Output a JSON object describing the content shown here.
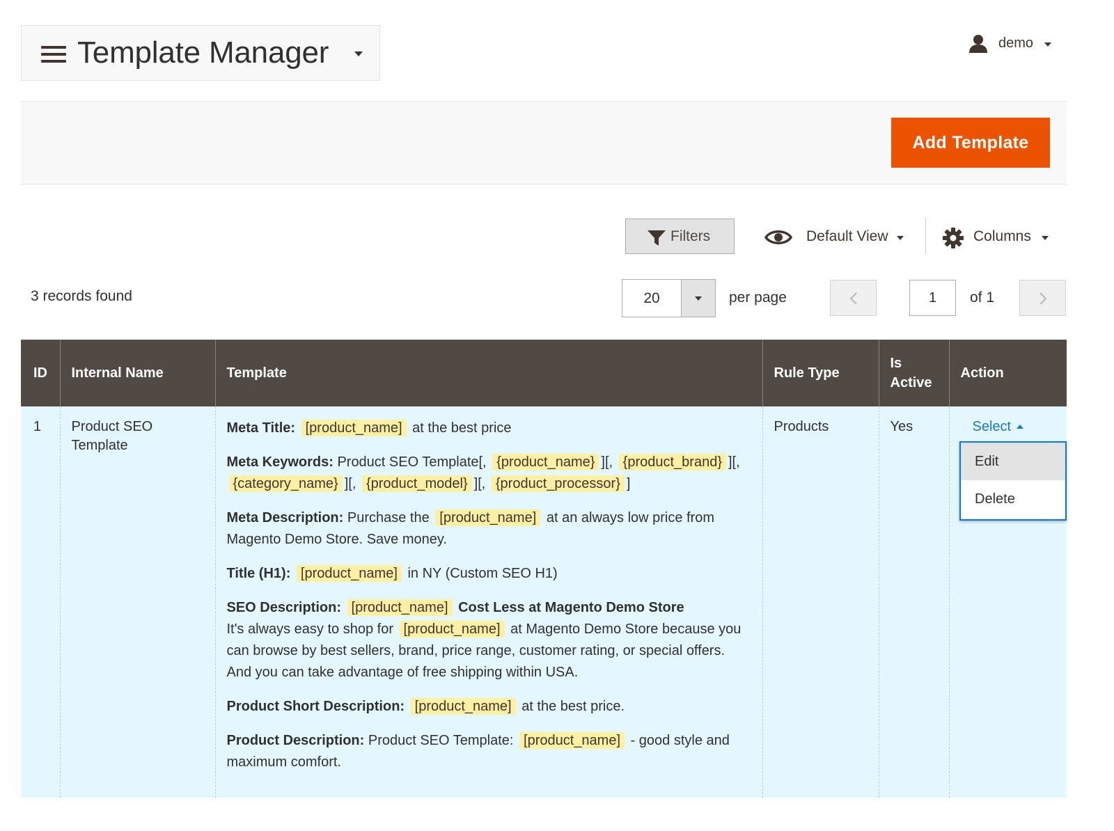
{
  "header": {
    "title": "Template Manager",
    "user_name": "demo"
  },
  "action_bar": {
    "add_label": "Add Template"
  },
  "toolbar": {
    "filters_label": "Filters",
    "view_label": "Default View",
    "columns_label": "Columns",
    "records_found": "3 records found",
    "per_page_value": "20",
    "per_page_label": "per page",
    "current_page": "1",
    "page_of": "of 1"
  },
  "grid": {
    "columns": [
      "ID",
      "Internal Name",
      "Template",
      "Rule Type",
      "Is Active",
      "Action"
    ],
    "rows": [
      {
        "id": "1",
        "internal_name": "Product SEO Template",
        "rule_type": "Products",
        "is_active": "Yes",
        "action_label": "Select",
        "template": {
          "meta_title_label": "Meta Title:",
          "meta_title_var": "[product_name]",
          "meta_title_rest": "at the best price",
          "meta_keywords_label": "Meta Keywords:",
          "meta_keywords_prefix": "Product SEO Template[,",
          "kw_var1": "{product_name}",
          "kw_sep1": "][,",
          "kw_var2": "{product_brand}",
          "kw_sep2": "][,",
          "kw_var3": "{category_name}",
          "kw_sep3": "][,",
          "kw_var4": "{product_model}",
          "kw_sep4": "][,",
          "kw_var5": "{product_processor}",
          "kw_end": "]",
          "meta_desc_label": "Meta Description:",
          "meta_desc_pre": "Purchase the",
          "meta_desc_var": "[product_name]",
          "meta_desc_rest": "at an always low price from Magento Demo Store. Save money.",
          "h1_label": "Title (H1):",
          "h1_var": "[product_name]",
          "h1_rest": "in NY (Custom SEO H1)",
          "seo_desc_label": "SEO Description:",
          "seo_desc_var1": "[product_name]",
          "seo_desc_bold": "Cost Less at Magento Demo Store",
          "seo_desc_pre2": "It's always easy to shop for",
          "seo_desc_var2": "[product_name]",
          "seo_desc_rest": "at Magento Demo Store because you can browse by best sellers, brand, price range, customer rating, or special offers. And you can take advantage of free shipping within USA.",
          "short_desc_label": "Product Short Description:",
          "short_desc_var": "[product_name]",
          "short_desc_rest": "at the best price.",
          "prod_desc_label": "Product Description:",
          "prod_desc_pre": "Product SEO Template:",
          "prod_desc_var": "[product_name]",
          "prod_desc_rest": "- good style and maximum comfort."
        }
      }
    ]
  },
  "action_menu": {
    "items": [
      "Edit",
      "Delete"
    ]
  },
  "colors": {
    "accent": "#eb5202",
    "header_bg": "#514943",
    "row_bg": "#e5f7fe",
    "link": "#1979c3",
    "variable_highlight": "#fdf0a5"
  },
  "icons": {
    "menu": "hamburger-icon",
    "user": "user-icon",
    "filters": "funnel-icon",
    "view": "eye-icon",
    "columns": "gear-icon"
  }
}
